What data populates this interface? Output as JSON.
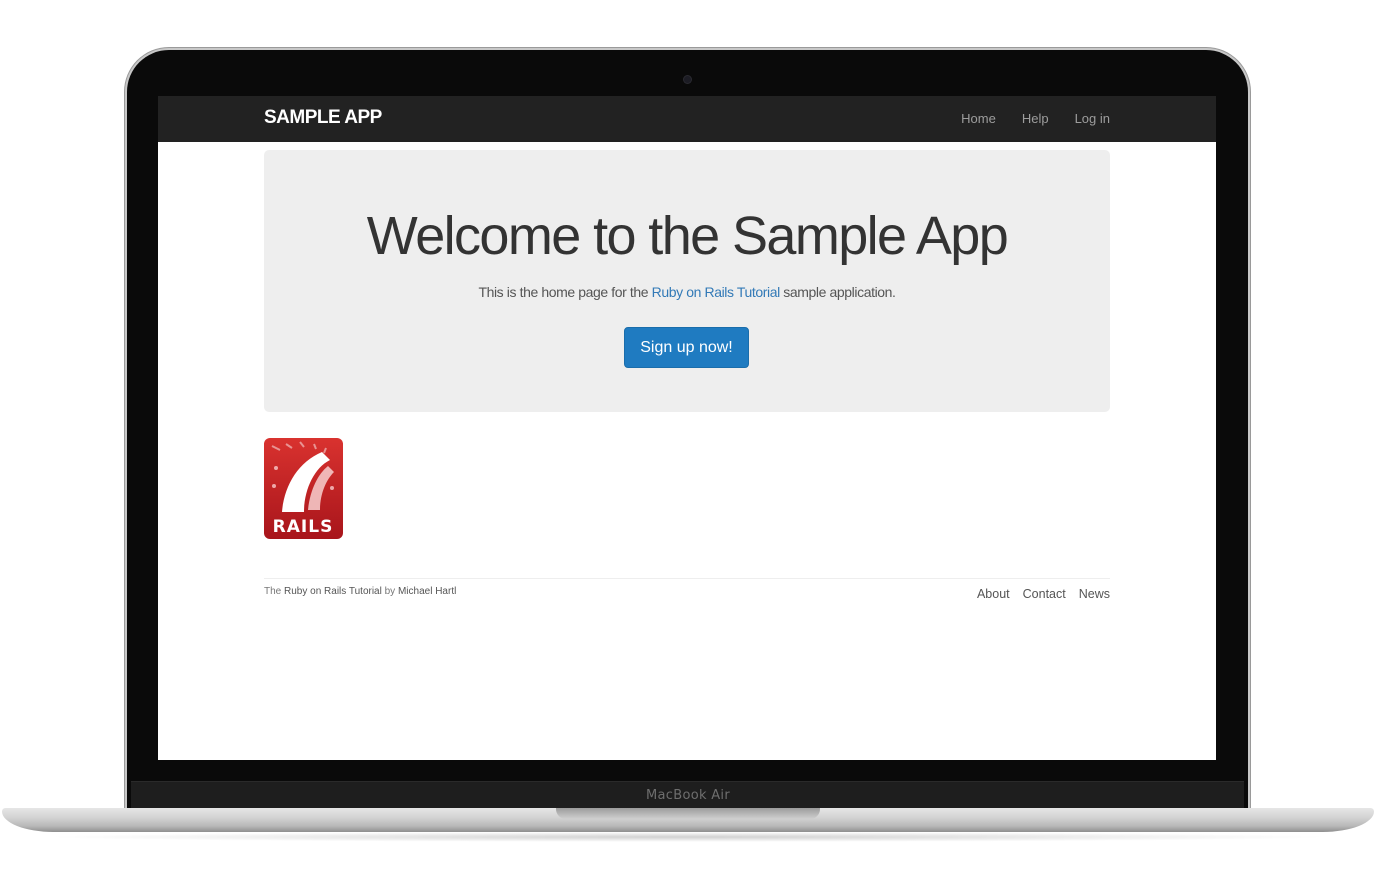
{
  "device": {
    "label": "MacBook Air"
  },
  "navbar": {
    "logo": "SAMPLE APP",
    "links": [
      {
        "label": "Home"
      },
      {
        "label": "Help"
      },
      {
        "label": "Log in"
      }
    ]
  },
  "hero": {
    "title": "Welcome to the Sample App",
    "subtitle_before": "This is the home page for the ",
    "subtitle_link": "Ruby on Rails Tutorial",
    "subtitle_after": " sample application.",
    "button_label": "Sign up now!"
  },
  "rails_logo": {
    "text": "RAILS",
    "color": "#c3201f"
  },
  "footer": {
    "prefix": "The ",
    "tutorial_link": "Ruby on Rails Tutorial",
    "by_text": " by ",
    "author_link": "Michael Hartl",
    "links": [
      {
        "label": "About"
      },
      {
        "label": "Contact"
      },
      {
        "label": "News"
      }
    ]
  },
  "colors": {
    "navbar_bg": "#222222",
    "jumbotron_bg": "#eeeeee",
    "primary_button": "#1f7bc1",
    "link": "#337ab7"
  }
}
